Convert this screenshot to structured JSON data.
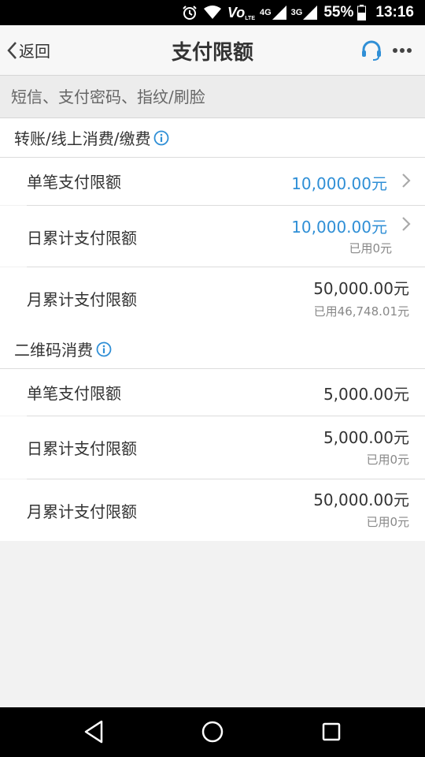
{
  "status_bar": {
    "battery": "55%",
    "time": "13:16",
    "net1": "4G",
    "net2": "3G",
    "volte": "Vo",
    "volte_sub": "LTE"
  },
  "nav": {
    "back_label": "返回",
    "title": "支付限额"
  },
  "auth_methods": "短信、支付密码、指纹/刷脸",
  "sections": [
    {
      "title": "转账/线上消费/缴费",
      "rows": [
        {
          "label": "单笔支付限额",
          "amount": "10,000.00元",
          "used": ""
        },
        {
          "label": "日累计支付限额",
          "amount": "10,000.00元",
          "used": "已用0元"
        },
        {
          "label": "月累计支付限额",
          "amount": "50,000.00元",
          "used": "已用46,748.01元"
        }
      ]
    },
    {
      "title": "二维码消费",
      "rows": [
        {
          "label": "单笔支付限额",
          "amount": "5,000.00元",
          "used": ""
        },
        {
          "label": "日累计支付限额",
          "amount": "5,000.00元",
          "used": "已用0元"
        },
        {
          "label": "月累计支付限额",
          "amount": "50,000.00元",
          "used": "已用0元"
        }
      ]
    }
  ],
  "colors": {
    "accent": "#2f8fd6",
    "background": "#f2f2f2",
    "text": "#333333",
    "muted": "#888888"
  },
  "icons": [
    "alarm-icon",
    "wifi-icon",
    "signal-icon",
    "battery-icon",
    "headset-icon",
    "more-icon",
    "info-icon",
    "chevron-right-icon",
    "back-icon",
    "home-icon",
    "recents-icon"
  ]
}
